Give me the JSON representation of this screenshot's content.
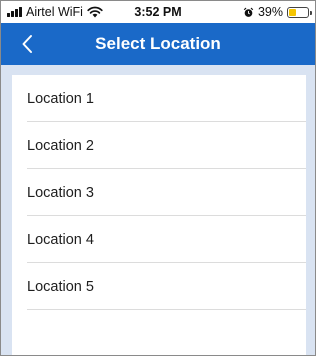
{
  "status_bar": {
    "carrier": "Airtel WiFi",
    "time": "3:52 PM",
    "battery_percent": "39%",
    "battery_level": 0.39,
    "icons": [
      "signal-icon",
      "wifi-icon",
      "alarm-icon",
      "battery-icon"
    ]
  },
  "header": {
    "title": "Select Location",
    "back_icon": "chevron-left-icon",
    "background_color": "#1a69c8"
  },
  "locations": [
    {
      "label": "Location 1"
    },
    {
      "label": "Location 2"
    },
    {
      "label": "Location 3"
    },
    {
      "label": "Location 4"
    },
    {
      "label": "Location 5"
    }
  ],
  "colors": {
    "accent": "#1a69c8",
    "page_background": "#d9e3f2",
    "battery": "#f4c400"
  }
}
